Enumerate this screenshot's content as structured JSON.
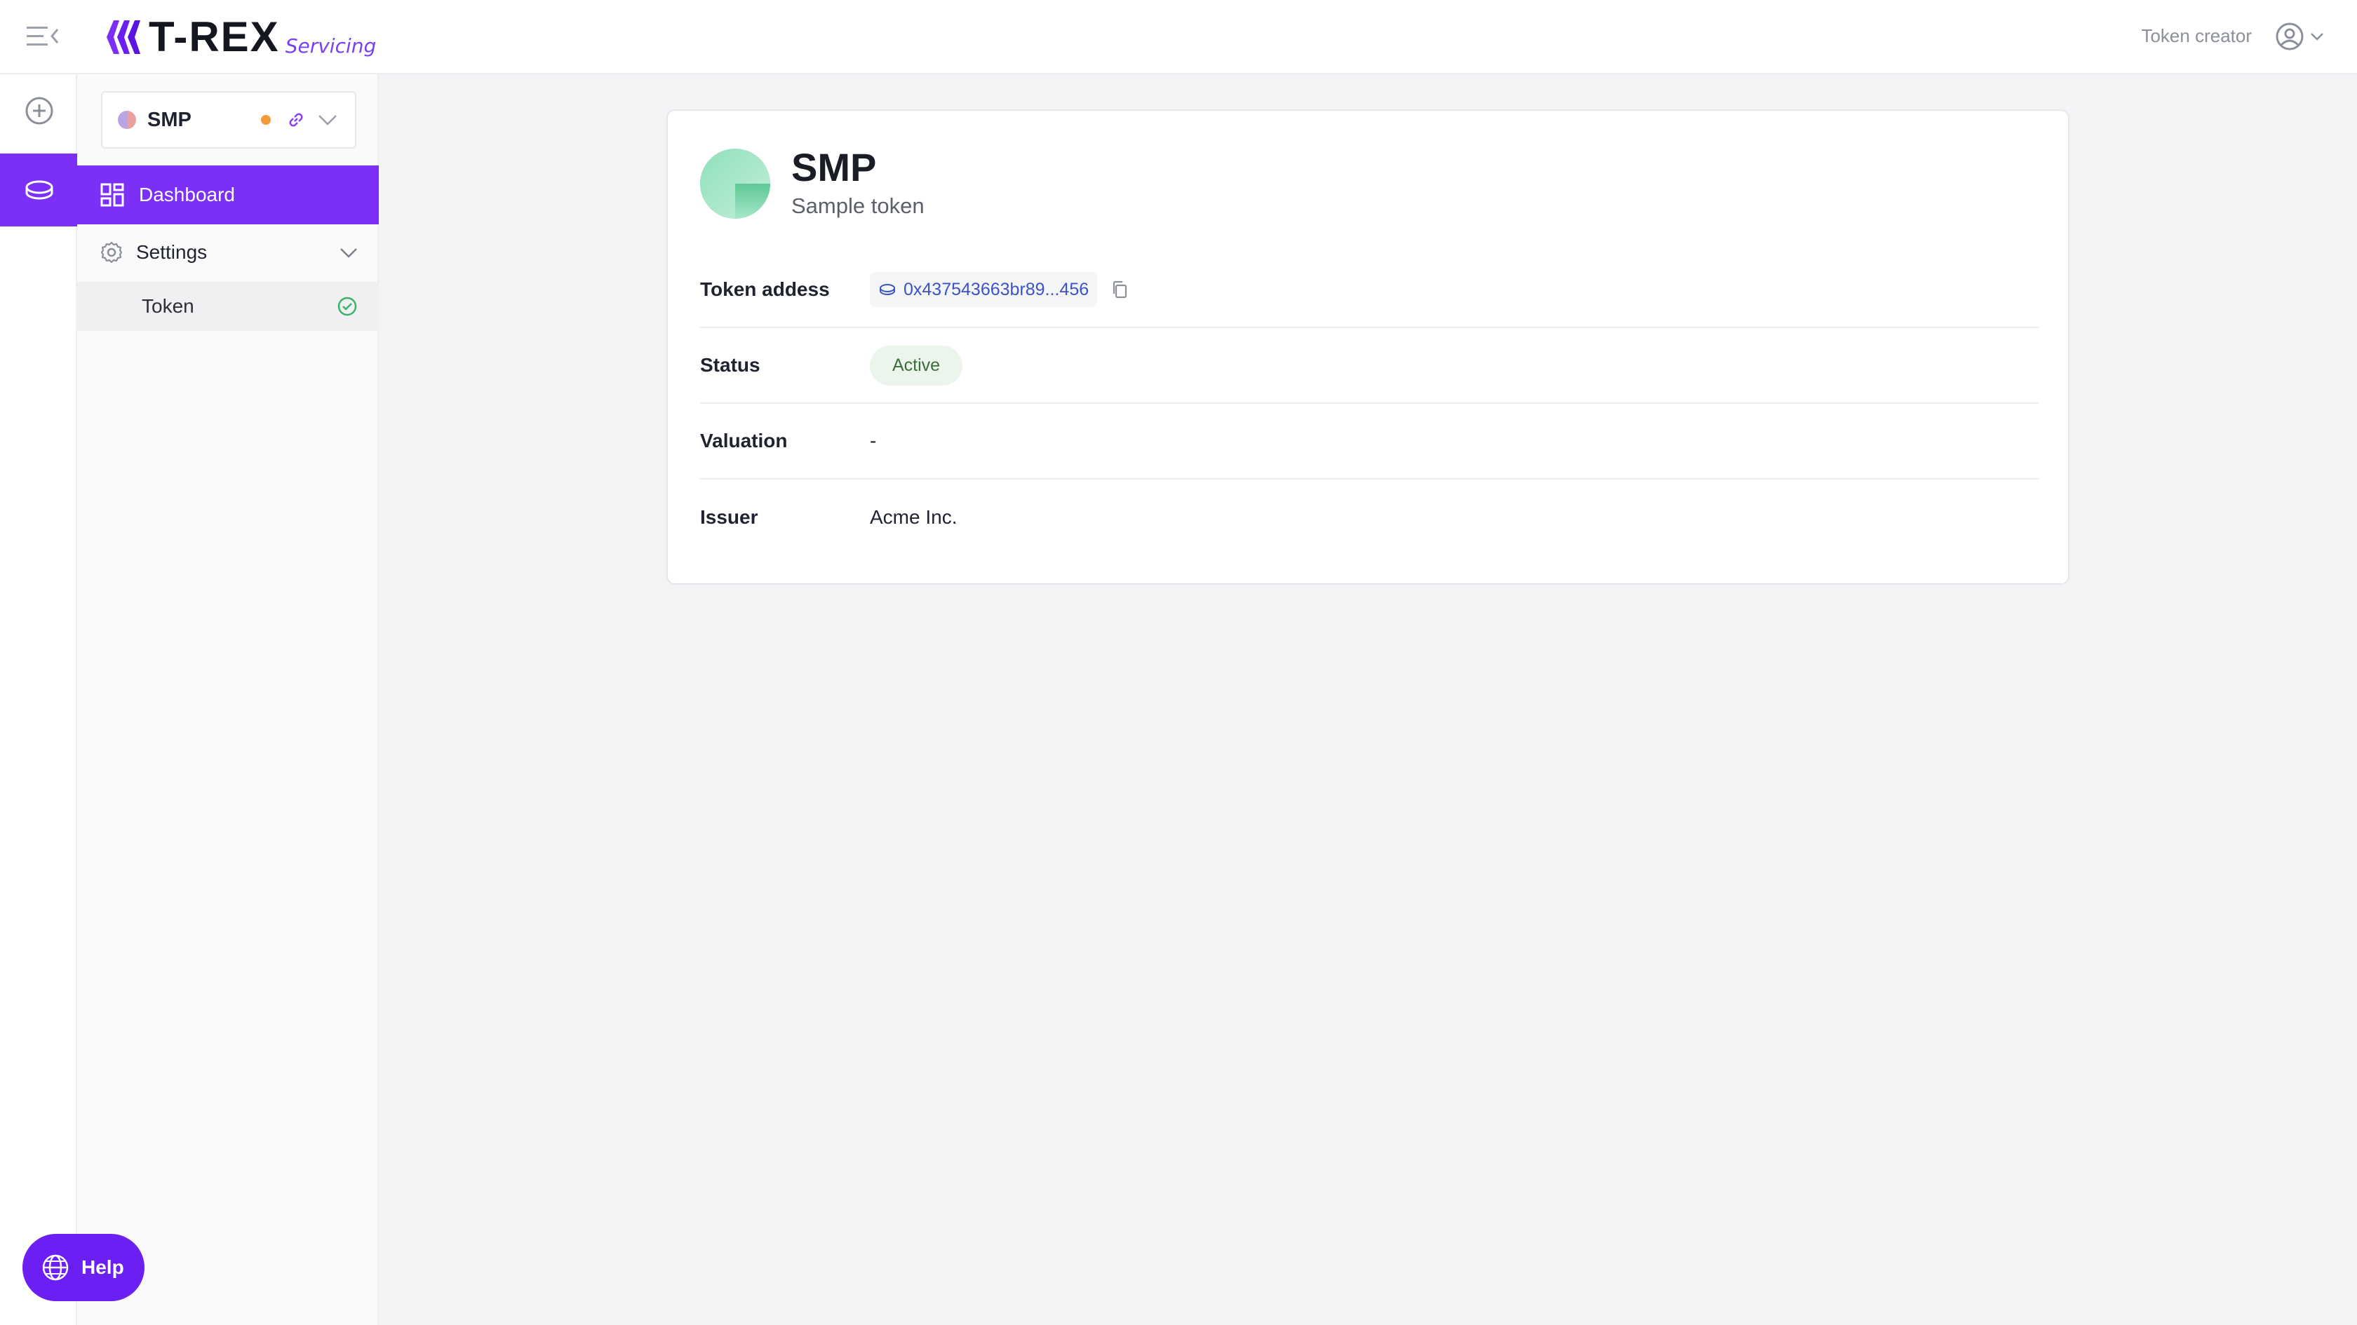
{
  "header": {
    "logo_text": "T-REX",
    "logo_sub": "Servicing",
    "role": "Token creator"
  },
  "sidebar": {
    "token_selector": {
      "symbol": "SMP"
    },
    "nav": {
      "dashboard": "Dashboard",
      "settings": "Settings",
      "token": "Token"
    },
    "help": "Help"
  },
  "token": {
    "symbol": "SMP",
    "name": "Sample token",
    "fields": {
      "address_label": "Token addess",
      "address_value": "0x437543663br89...456",
      "status_label": "Status",
      "status_value": "Active",
      "valuation_label": "Valuation",
      "valuation_value": "-",
      "issuer_label": "Issuer",
      "issuer_value": "Acme Inc."
    }
  },
  "colors": {
    "accent": "#7b2ff7",
    "status_active_bg": "#ecf5ec",
    "status_active_text": "#3b6e3b",
    "link": "#3d52c7",
    "pending_dot": "#f29a38"
  }
}
